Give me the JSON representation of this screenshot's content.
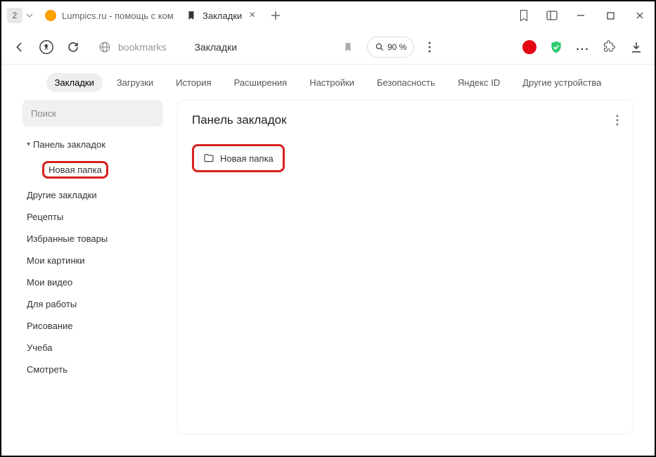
{
  "titlebar": {
    "group_count": "2",
    "tabs": [
      {
        "title": "Lumpics.ru - помощь с ком",
        "active": false
      },
      {
        "title": "Закладки",
        "active": true
      }
    ]
  },
  "toolbar": {
    "address_host": "bookmarks",
    "address_title": "Закладки",
    "zoom": "90 %"
  },
  "nav": {
    "items": [
      "Закладки",
      "Загрузки",
      "История",
      "Расширения",
      "Настройки",
      "Безопасность",
      "Яндекс ID",
      "Другие устройства"
    ],
    "active_index": 0
  },
  "sidebar": {
    "search_placeholder": "Поиск",
    "tree_header": "Панель закладок",
    "new_folder": "Новая папка",
    "items": [
      "Другие закладки",
      "Рецепты",
      "Избранные товары",
      "Мои картинки",
      "Мои видео",
      "Для работы",
      "Рисование",
      "Учеба",
      "Смотреть"
    ]
  },
  "main": {
    "title": "Панель закладок",
    "folder_label": "Новая папка"
  }
}
